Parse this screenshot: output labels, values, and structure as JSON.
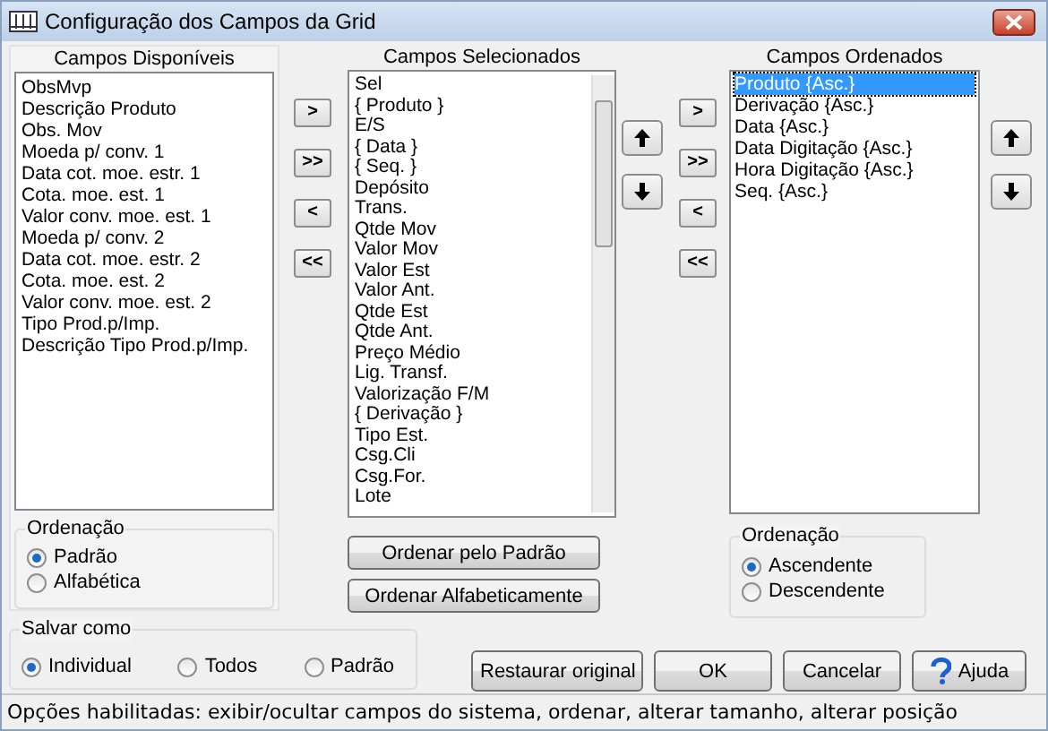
{
  "window": {
    "title": "Configuração dos Campos da Grid"
  },
  "available": {
    "heading": "Campos Disponíveis",
    "items": [
      {
        "label": "ObsMvp",
        "selected": false
      },
      {
        "label": "Descrição Produto",
        "selected": false
      },
      {
        "label": "Obs. Mov",
        "selected": false
      },
      {
        "label": "Moeda p/ conv. 1",
        "selected": false
      },
      {
        "label": "Data cot. moe. estr. 1",
        "selected": false
      },
      {
        "label": "Cota. moe. est. 1",
        "selected": false
      },
      {
        "label": "Valor conv. moe. est. 1",
        "selected": false
      },
      {
        "label": "Moeda p/ conv. 2",
        "selected": false
      },
      {
        "label": "Data cot. moe. estr. 2",
        "selected": false
      },
      {
        "label": "Cota. moe. est. 2",
        "selected": false
      },
      {
        "label": "Valor conv. moe. est. 2",
        "selected": false
      },
      {
        "label": "Tipo Prod.p/Imp.",
        "selected": false
      },
      {
        "label": "Descrição Tipo Prod.p/Imp.",
        "selected": false
      }
    ]
  },
  "move_buttons_left": [
    ">",
    ">>",
    "<",
    "<<"
  ],
  "chosen": {
    "heading": "Campos Selecionados",
    "items": [
      {
        "label": "Sel",
        "selected": false
      },
      {
        "label": "{ Produto }",
        "selected": false
      },
      {
        "label": "E/S",
        "selected": false
      },
      {
        "label": "{ Data }",
        "selected": false
      },
      {
        "label": "{ Seq. }",
        "selected": false
      },
      {
        "label": "Depósito",
        "selected": false
      },
      {
        "label": "Trans.",
        "selected": false
      },
      {
        "label": "Qtde Mov",
        "selected": false
      },
      {
        "label": "Valor Mov",
        "selected": false
      },
      {
        "label": "Valor Est",
        "selected": false
      },
      {
        "label": "Valor Ant.",
        "selected": false
      },
      {
        "label": "Qtde Est",
        "selected": false
      },
      {
        "label": "Qtde Ant.",
        "selected": false
      },
      {
        "label": "Preço Médio",
        "selected": false
      },
      {
        "label": "Lig. Transf.",
        "selected": false
      },
      {
        "label": "Valorização F/M",
        "selected": false
      },
      {
        "label": "{ Derivação }",
        "selected": false
      },
      {
        "label": "Tipo Est.",
        "selected": false
      },
      {
        "label": "Csg.Cli",
        "selected": false
      },
      {
        "label": "Csg.For.",
        "selected": false
      },
      {
        "label": "Lote",
        "selected": false
      }
    ]
  },
  "sort_buttons": [
    "Ordenar pelo Padrão",
    "Ordenar Alfabeticamente"
  ],
  "move_buttons_right": [
    ">",
    ">>",
    "<",
    "<<"
  ],
  "ordered": {
    "heading": "Campos Ordenados",
    "items": [
      {
        "label": "Produto {Asc.}",
        "selected": true
      },
      {
        "label": "Derivação {Asc.}",
        "selected": false
      },
      {
        "label": "Data {Asc.}",
        "selected": false
      },
      {
        "label": "Data Digitação {Asc.}",
        "selected": false
      },
      {
        "label": "Hora Digitação {Asc.}",
        "selected": false
      },
      {
        "label": "Seq. {Asc.}",
        "selected": false
      }
    ]
  },
  "available_ordering": {
    "title": "Ordenação",
    "options": [
      {
        "label": "Padrão",
        "selected": true
      },
      {
        "label": "Alfabética",
        "selected": false
      }
    ]
  },
  "ordered_ordering": {
    "title": "Ordenação",
    "options": [
      {
        "label": "Ascendente",
        "selected": true
      },
      {
        "label": "Descendente",
        "selected": false
      }
    ]
  },
  "save_as": {
    "title": "Salvar como",
    "options": [
      {
        "label": "Individual",
        "selected": true
      },
      {
        "label": "Todos",
        "selected": false
      },
      {
        "label": "Padrão",
        "selected": false
      }
    ]
  },
  "buttons": [
    {
      "label": "Restaurar original",
      "kind": "plain"
    },
    {
      "label": "OK",
      "kind": "plain"
    },
    {
      "label": "Cancelar",
      "kind": "plain"
    },
    {
      "label": "Ajuda",
      "kind": "help"
    }
  ],
  "status_bar": "Opções habilitadas: exibir/ocultar campos do sistema, ordenar, alterar tamanho, alterar posição"
}
